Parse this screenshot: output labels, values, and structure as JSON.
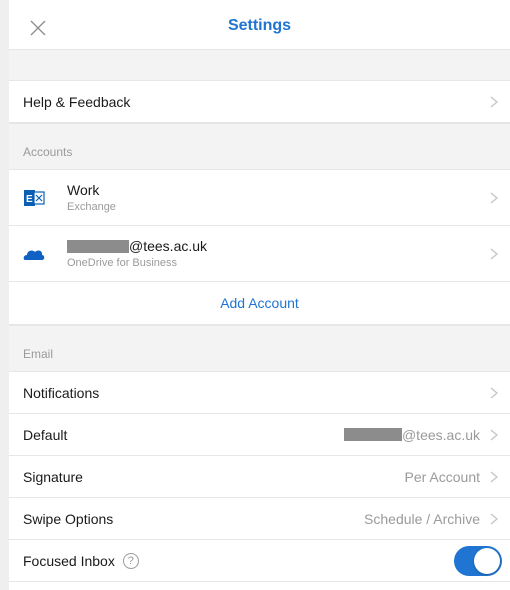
{
  "header": {
    "title": "Settings",
    "close_icon": "close-icon"
  },
  "help": {
    "label": "Help & Feedback"
  },
  "accounts": {
    "section_title": "Accounts",
    "items": [
      {
        "name": "Work",
        "type": "Exchange",
        "icon": "exchange-icon"
      },
      {
        "name": "@tees.ac.uk",
        "type": "OneDrive for Business",
        "icon": "onedrive-icon"
      }
    ],
    "add_label": "Add Account"
  },
  "email": {
    "section_title": "Email",
    "notifications": {
      "label": "Notifications"
    },
    "default": {
      "label": "Default",
      "value": "@tees.ac.uk"
    },
    "signature": {
      "label": "Signature",
      "value": "Per Account"
    },
    "swipe": {
      "label": "Swipe Options",
      "value": "Schedule / Archive"
    },
    "focused": {
      "label": "Focused Inbox",
      "help_glyph": "?",
      "enabled": true
    }
  },
  "colors": {
    "accent": "#1f75d1",
    "exchange": "#0a5fb4",
    "onedrive": "#0f62c4"
  }
}
